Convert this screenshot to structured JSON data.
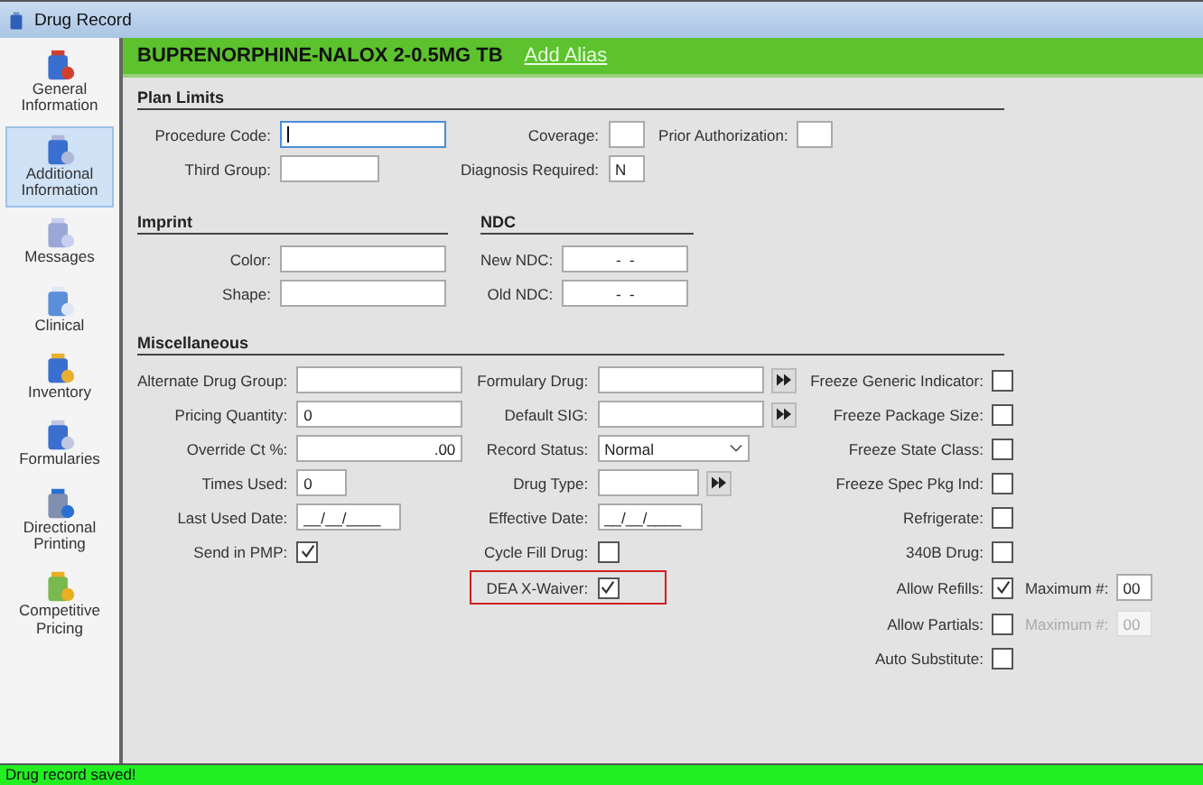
{
  "window": {
    "title": "Drug Record"
  },
  "sidebar": {
    "items": [
      {
        "label": "General Information",
        "selected": false
      },
      {
        "label": "Additional Information",
        "selected": true
      },
      {
        "label": "Messages",
        "selected": false
      },
      {
        "label": "Clinical",
        "selected": false
      },
      {
        "label": "Inventory",
        "selected": false
      },
      {
        "label": "Formularies",
        "selected": false
      },
      {
        "label": "Directional Printing",
        "selected": false
      },
      {
        "label": "Competitive Pricing",
        "selected": false
      }
    ]
  },
  "header": {
    "drug_name": "BUPRENORPHINE-NALOX 2-0.5MG TB",
    "link": "Add Alias"
  },
  "section_rows": [
    [
      {
        "title": "Plan Limits",
        "columns": [
          [
            {
              "label": "Procedure Code:",
              "kind": "text",
              "focused": true
            },
            {
              "label": "Third Group:",
              "kind": "short-text"
            }
          ],
          [
            {
              "label": "Coverage:",
              "kind": "char"
            },
            {
              "label": "Diagnosis Required:",
              "kind": "char",
              "value": "N"
            }
          ],
          [
            {
              "label": "Prior Authorization:",
              "kind": "char"
            }
          ]
        ]
      }
    ],
    [
      {
        "title": "Imprint",
        "columns": [
          [
            {
              "label": "Color:",
              "kind": "text"
            },
            {
              "label": "Shape:",
              "kind": "text"
            }
          ]
        ]
      },
      {
        "title": "NDC",
        "columns": [
          [
            {
              "label": "New NDC:",
              "kind": "text",
              "value": "-  -"
            },
            {
              "label": "Old NDC:",
              "kind": "text",
              "value": "-  -"
            }
          ]
        ]
      }
    ],
    [
      {
        "title": "Miscellaneous",
        "columns": [
          [
            {
              "label": "Alternate Drug Group:",
              "kind": "text"
            },
            {
              "label": "Pricing Quantity:",
              "kind": "text",
              "value": "0"
            },
            {
              "label": "Override Ct %:",
              "kind": "number",
              "value": ".00"
            },
            {
              "label": "Times Used:",
              "kind": "short-text",
              "value": "0"
            },
            {
              "label": "Last Used Date:",
              "kind": "date",
              "value": "__/__/____"
            },
            {
              "label": "Send in PMP:",
              "kind": "check",
              "checked": true
            }
          ],
          [
            {
              "label": "Formulary Drug:",
              "kind": "lookup"
            },
            {
              "label": "Default SIG:",
              "kind": "lookup"
            },
            {
              "label": "Record Status:",
              "kind": "select",
              "value": "Normal"
            },
            {
              "label": "Drug Type:",
              "kind": "short-lookup"
            },
            {
              "label": "Effective Date:",
              "kind": "date",
              "value": "__/__/____"
            },
            {
              "label": "Cycle Fill Drug:",
              "kind": "check",
              "checked": false
            },
            {
              "label": "DEA X-Waiver:",
              "kind": "check",
              "checked": true,
              "highlighted": true
            }
          ],
          [
            {
              "label": "Freeze Generic Indicator:",
              "kind": "check",
              "checked": false
            },
            {
              "label": "Freeze Package Size:",
              "kind": "check",
              "checked": false
            },
            {
              "label": "Freeze State Class:",
              "kind": "check",
              "checked": false
            },
            {
              "label": "Freeze Spec Pkg Ind:",
              "kind": "check",
              "checked": false
            },
            {
              "label": "Refrigerate:",
              "kind": "check",
              "checked": false
            },
            {
              "label": "340B Drug:",
              "kind": "check",
              "checked": false
            },
            {
              "label": "Allow Refills:",
              "kind": "check",
              "checked": true,
              "maximum": {
                "label": "Maximum #:",
                "value": "00",
                "disabled": false
              }
            },
            {
              "label": "Allow Partials:",
              "kind": "check",
              "checked": false,
              "maximum": {
                "label": "Maximum #:",
                "value": "00",
                "disabled": true
              }
            },
            {
              "label": "Auto Substitute:",
              "kind": "check",
              "checked": false
            }
          ]
        ]
      }
    ]
  ],
  "status_bar": {
    "text": "Drug record saved!"
  }
}
